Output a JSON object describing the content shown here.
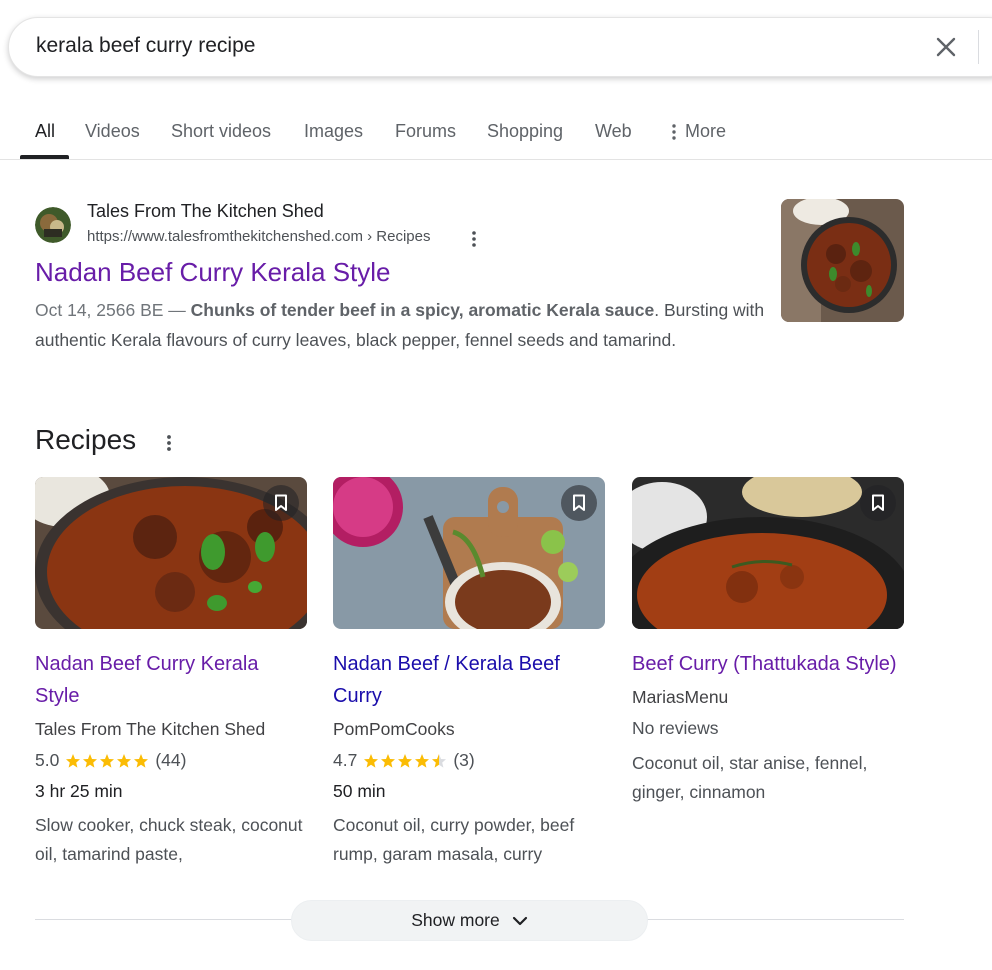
{
  "search": {
    "query": "kerala beef curry recipe"
  },
  "tabs": [
    {
      "label": "All"
    },
    {
      "label": "Videos"
    },
    {
      "label": "Short videos"
    },
    {
      "label": "Images"
    },
    {
      "label": "Forums"
    },
    {
      "label": "Shopping"
    },
    {
      "label": "Web"
    },
    {
      "label": "More"
    }
  ],
  "result": {
    "site_name": "Tales From The Kitchen Shed",
    "url": "https://www.talesfromthekitchenshed.com › Recipes",
    "title": "Nadan Beef Curry Kerala Style",
    "date": "Oct 14, 2566 BE —",
    "snippet_bold": "Chunks of tender beef in a spicy, aromatic Kerala sauce",
    "snippet_rest": ". Bursting with authentic Kerala flavours of curry leaves, black pepper, fennel seeds and tamarind."
  },
  "recipes": {
    "heading": "Recipes",
    "cards": [
      {
        "title": "Nadan Beef Curry Kerala Style",
        "source": "Tales From The Kitchen Shed",
        "rating": "5.0",
        "stars": 5,
        "reviews": "(44)",
        "time": "3 hr 25 min",
        "ingredients": "Slow cooker, chuck steak, coconut oil, tamarind paste,"
      },
      {
        "title": "Nadan Beef / Kerala Beef Curry",
        "source": "PomPomCooks",
        "rating": "4.7",
        "stars": 4.5,
        "reviews": "(3)",
        "time": "50 min",
        "ingredients": "Coconut oil, curry powder, beef rump, garam masala, curry"
      },
      {
        "title": "Beef Curry (Thattukada Style)",
        "source": "MariasMenu",
        "no_reviews": "No reviews",
        "ingredients": "Coconut oil, star anise, fennel, ginger, cinnamon"
      }
    ]
  },
  "show_more": "Show more",
  "colors": {
    "visited_link": "#681da8",
    "link": "#1a0dab",
    "star": "#fbbc04"
  }
}
